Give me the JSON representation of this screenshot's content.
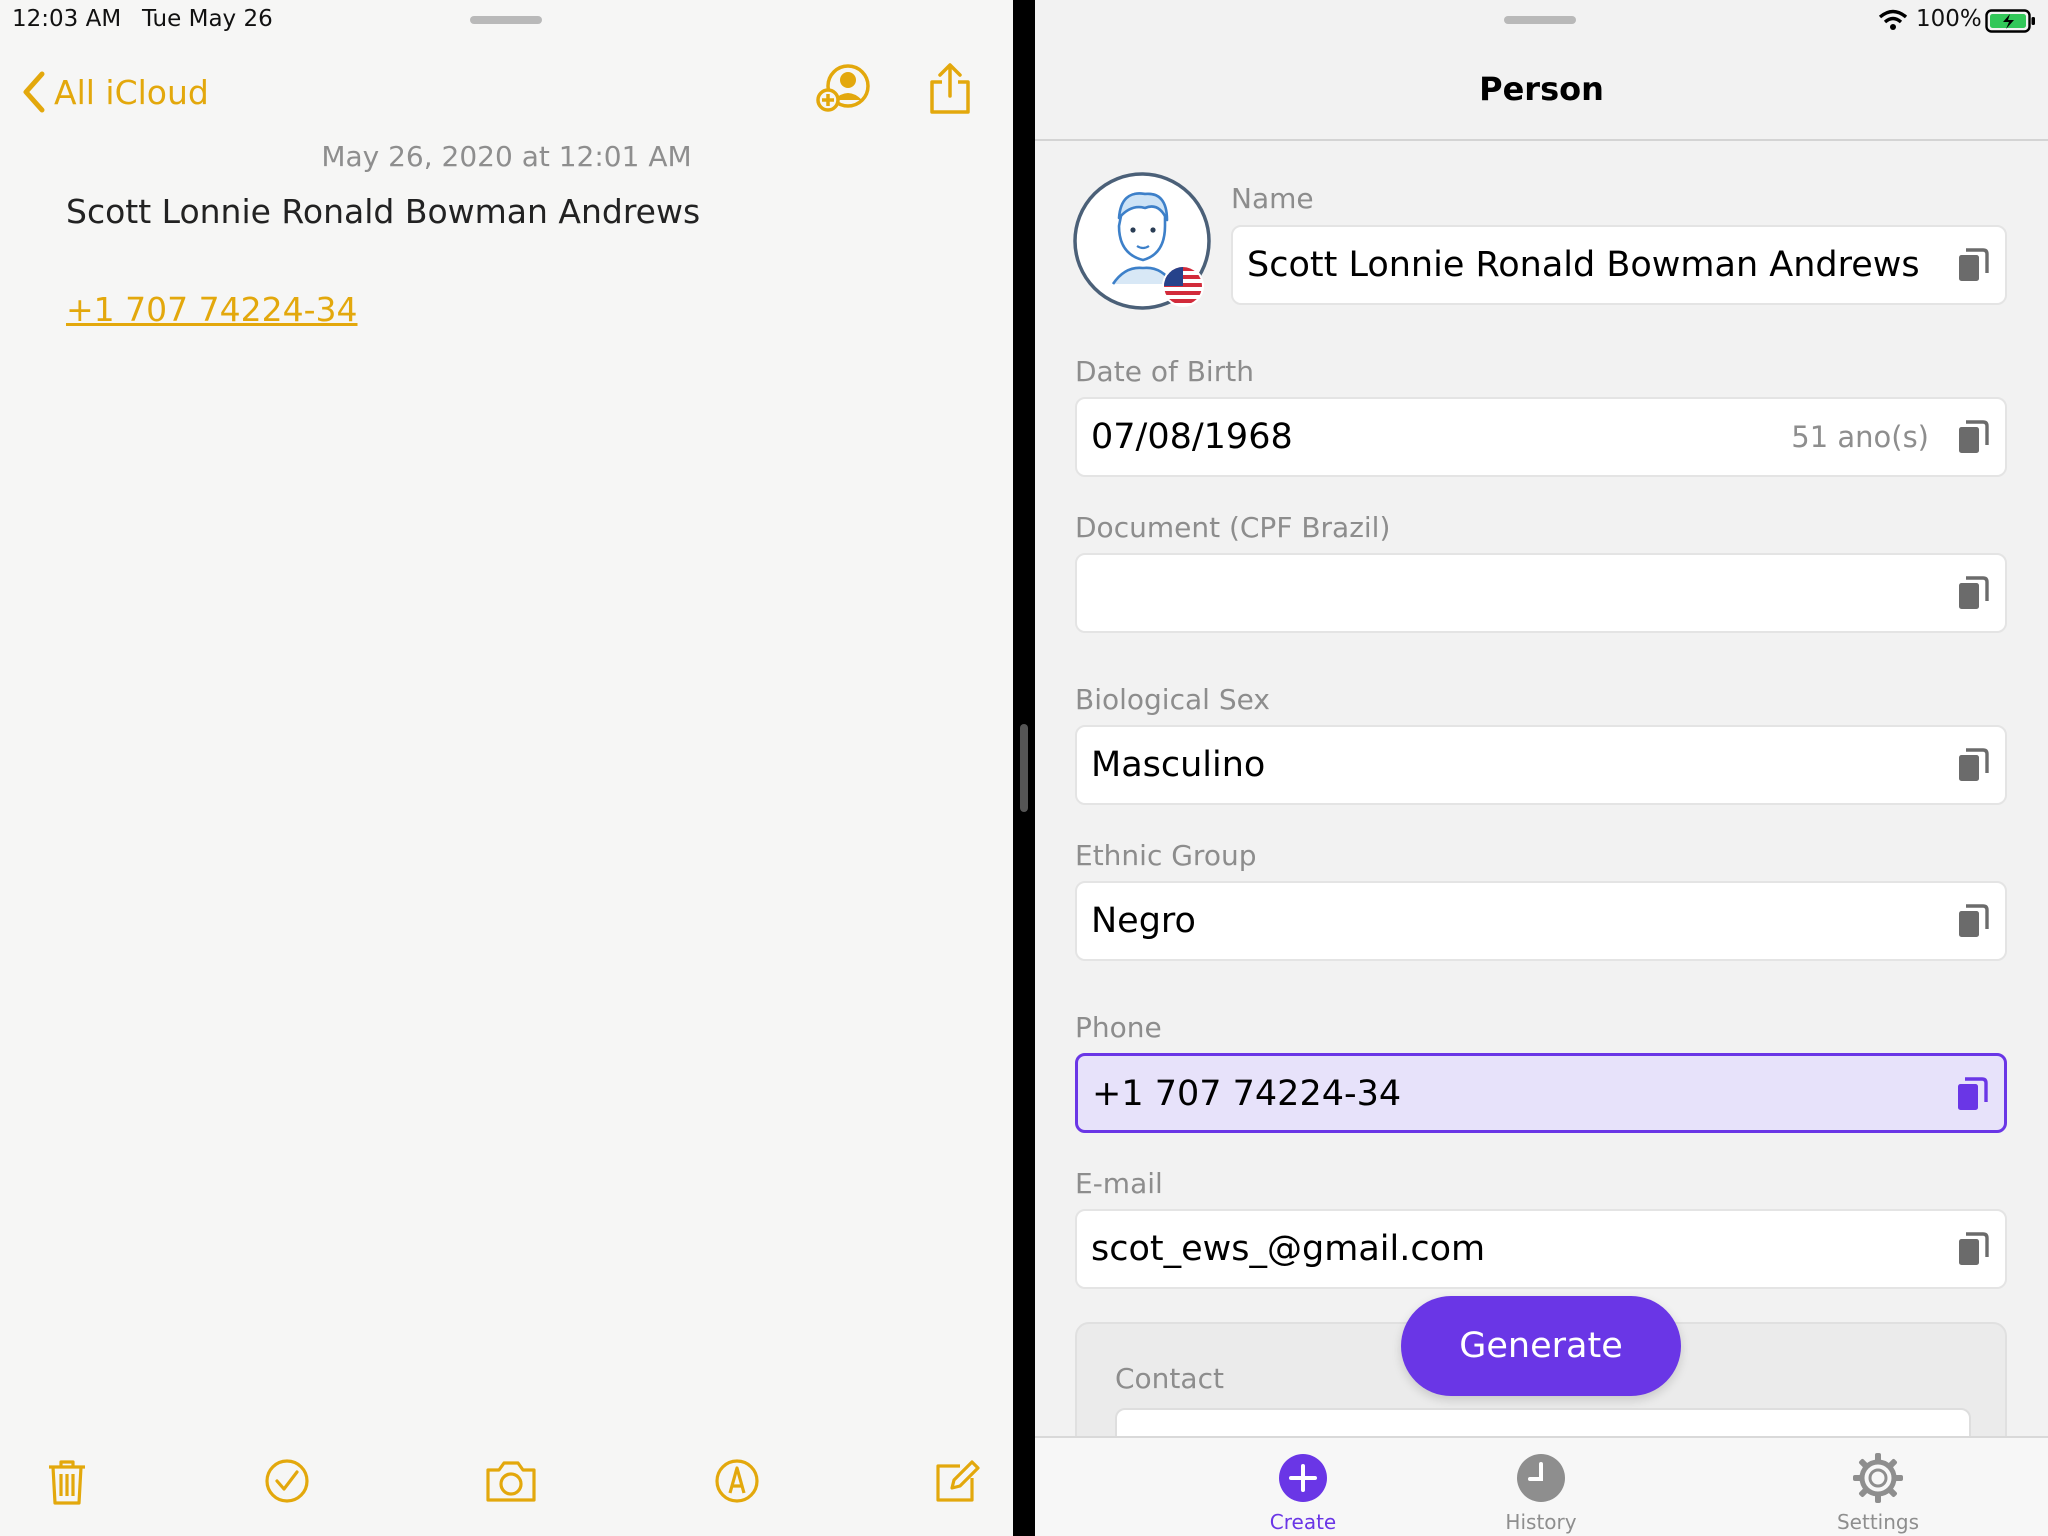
{
  "status_bar": {
    "time": "12:03 AM",
    "date": "Tue May 26",
    "battery": "100%"
  },
  "notes": {
    "back_label": "All iCloud",
    "note_date": "May 26, 2020 at 12:01 AM",
    "note_title": "Scott Lonnie Ronald Bowman Andrews",
    "note_phone": "+1 707 74224-34",
    "toolbar_icons": [
      "trash-icon",
      "checklist-icon",
      "camera-icon",
      "markup-icon",
      "compose-icon"
    ],
    "accent_color": "#e3a80c"
  },
  "person": {
    "nav_title": "Person",
    "name": {
      "label": "Name",
      "value": "Scott Lonnie Ronald Bowman Andrews"
    },
    "dob": {
      "label": "Date of Birth",
      "value": "07/08/1968",
      "age": "51 ano(s)"
    },
    "document": {
      "label": "Document (CPF Brazil)",
      "value": ""
    },
    "sex": {
      "label": "Biological Sex",
      "value": "Masculino"
    },
    "ethnic": {
      "label": "Ethnic Group",
      "value": "Negro"
    },
    "phone": {
      "label": "Phone",
      "value": "+1 707 74224-34"
    },
    "email": {
      "label": "E-mail",
      "value": "scot_ews_@gmail.com"
    },
    "contact": {
      "label": "Contact"
    },
    "generate_label": "Generate",
    "accent_color": "#6a36e6"
  },
  "tabbar": {
    "tabs": [
      {
        "label": "Create",
        "icon": "plus-circle-icon",
        "active": true
      },
      {
        "label": "History",
        "icon": "clock-icon",
        "active": false
      },
      {
        "label": "Settings",
        "icon": "gear-icon",
        "active": false
      }
    ]
  }
}
